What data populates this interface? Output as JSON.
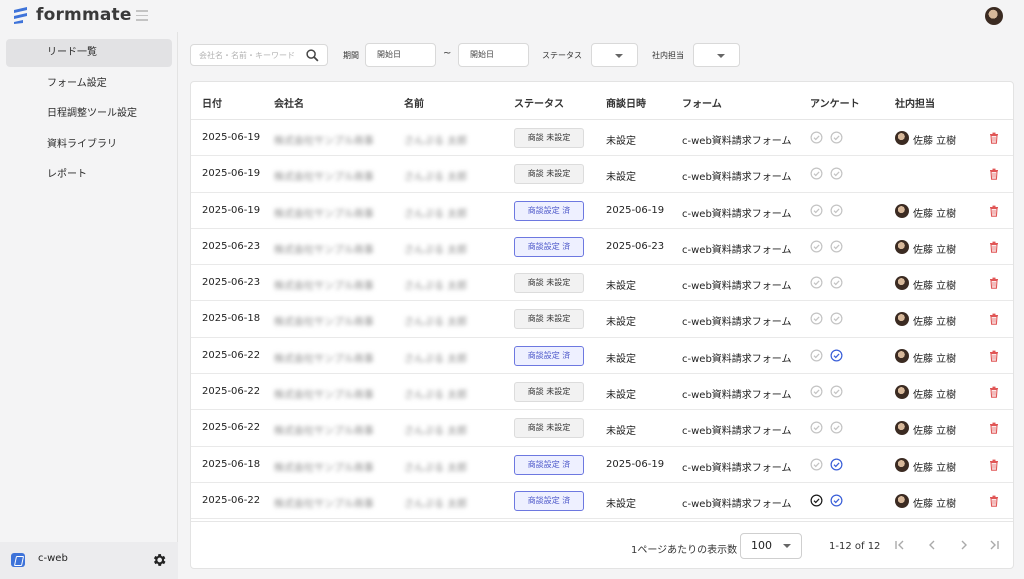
{
  "app": {
    "name": "formmate"
  },
  "sidebar": {
    "items": [
      {
        "label": "リード一覧",
        "active": true
      },
      {
        "label": "フォーム設定",
        "active": false
      },
      {
        "label": "日程調整ツール設定",
        "active": false
      },
      {
        "label": "資料ライブラリ",
        "active": false
      },
      {
        "label": "レポート",
        "active": false
      }
    ],
    "workspace": "c-web"
  },
  "filters": {
    "search_placeholder": "会社名・名前・キーワード",
    "period_label": "期間",
    "start_placeholder": "開始日",
    "end_placeholder": "開始日",
    "tilde": "~",
    "status_label": "ステータス",
    "owner_label": "社内担当"
  },
  "table": {
    "headers": [
      "日付",
      "会社名",
      "名前",
      "ステータス",
      "商談日時",
      "フォーム",
      "アンケート",
      "社内担当"
    ],
    "rows": [
      {
        "date": "2025-06-19",
        "company": "株式会社サンプル商事",
        "name": "さんぷる 太郎",
        "status": "商談 未設定",
        "status_set": false,
        "meeting": "未設定",
        "form": "c-web資料請求フォーム",
        "survey": [
          "gray",
          "gray"
        ],
        "owner": "佐藤 立樹"
      },
      {
        "date": "2025-06-19",
        "company": "株式会社サンプル商事",
        "name": "さんぷる 太郎",
        "status": "商談 未設定",
        "status_set": false,
        "meeting": "未設定",
        "form": "c-web資料請求フォーム",
        "survey": [
          "gray",
          "gray"
        ],
        "owner": ""
      },
      {
        "date": "2025-06-19",
        "company": "株式会社サンプル商事",
        "name": "さんぷる 太郎",
        "status": "商談設定 済",
        "status_set": true,
        "meeting": "2025-06-19",
        "form": "c-web資料請求フォーム",
        "survey": [
          "gray",
          "gray"
        ],
        "owner": "佐藤 立樹"
      },
      {
        "date": "2025-06-23",
        "company": "株式会社サンプル商事",
        "name": "さんぷる 太郎",
        "status": "商談設定 済",
        "status_set": true,
        "meeting": "2025-06-23",
        "form": "c-web資料請求フォーム",
        "survey": [
          "gray",
          "gray"
        ],
        "owner": "佐藤 立樹"
      },
      {
        "date": "2025-06-23",
        "company": "株式会社サンプル商事",
        "name": "さんぷる 太郎",
        "status": "商談 未設定",
        "status_set": false,
        "meeting": "未設定",
        "form": "c-web資料請求フォーム",
        "survey": [
          "gray",
          "gray"
        ],
        "owner": "佐藤 立樹"
      },
      {
        "date": "2025-06-18",
        "company": "株式会社サンプル商事",
        "name": "さんぷる 太郎",
        "status": "商談 未設定",
        "status_set": false,
        "meeting": "未設定",
        "form": "c-web資料請求フォーム",
        "survey": [
          "gray",
          "gray"
        ],
        "owner": "佐藤 立樹"
      },
      {
        "date": "2025-06-22",
        "company": "株式会社サンプル商事",
        "name": "さんぷる 太郎",
        "status": "商談設定 済",
        "status_set": true,
        "meeting": "未設定",
        "form": "c-web資料請求フォーム",
        "survey": [
          "gray",
          "blue"
        ],
        "owner": "佐藤 立樹"
      },
      {
        "date": "2025-06-22",
        "company": "株式会社サンプル商事",
        "name": "さんぷる 太郎",
        "status": "商談 未設定",
        "status_set": false,
        "meeting": "未設定",
        "form": "c-web資料請求フォーム",
        "survey": [
          "gray",
          "gray"
        ],
        "owner": "佐藤 立樹"
      },
      {
        "date": "2025-06-22",
        "company": "株式会社サンプル商事",
        "name": "さんぷる 太郎",
        "status": "商談 未設定",
        "status_set": false,
        "meeting": "未設定",
        "form": "c-web資料請求フォーム",
        "survey": [
          "gray",
          "gray"
        ],
        "owner": "佐藤 立樹"
      },
      {
        "date": "2025-06-18",
        "company": "株式会社サンプル商事",
        "name": "さんぷる 太郎",
        "status": "商談設定 済",
        "status_set": true,
        "meeting": "2025-06-19",
        "form": "c-web資料請求フォーム",
        "survey": [
          "gray",
          "blue"
        ],
        "owner": "佐藤 立樹"
      },
      {
        "date": "2025-06-22",
        "company": "株式会社サンプル商事",
        "name": "さんぷる 太郎",
        "status": "商談設定 済",
        "status_set": true,
        "meeting": "未設定",
        "form": "c-web資料請求フォーム",
        "survey": [
          "black",
          "blue"
        ],
        "owner": "佐藤 立樹"
      }
    ]
  },
  "pagination": {
    "per_page_label": "1ページあたりの表示数",
    "per_page_value": "100",
    "range": "1-12 of 12"
  },
  "colors": {
    "accent": "#3e73d9",
    "status_set": "#6d78e0",
    "delete": "#e05656",
    "survey_blue": "#3a5fd8"
  }
}
